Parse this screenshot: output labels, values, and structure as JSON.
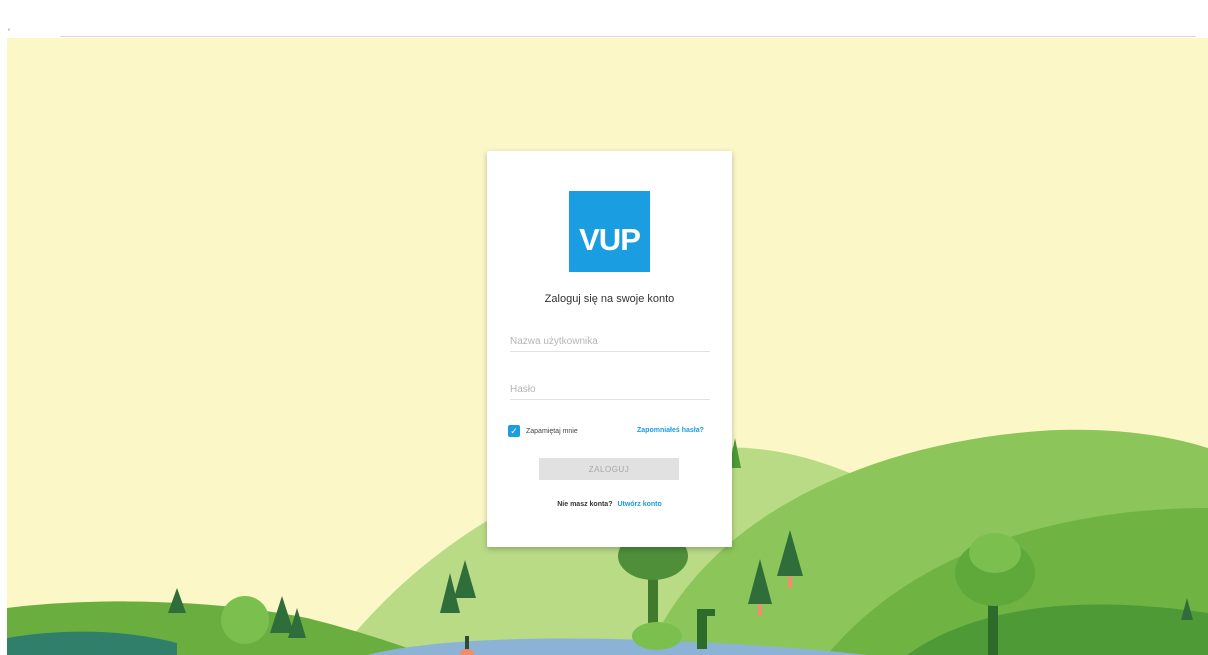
{
  "colors": {
    "background": "#fbf7c7",
    "accent": "#1a9de1",
    "hill_dark": "#5fa83a",
    "hill_light": "#b5d97f",
    "water": "#8cb3d6"
  },
  "logo": {
    "text": "VUP"
  },
  "login": {
    "title": "Zaloguj się na swoje konto",
    "username_placeholder": "Nazwa użytkownika",
    "username_value": "",
    "password_placeholder": "Hasło",
    "password_value": "",
    "remember_label": "Zapamiętaj mnie",
    "remember_checked": true,
    "forgot_link": "Zapomniałeś hasła?",
    "login_button": "ZALOGUJ",
    "no_account_text": "Nie masz konta?",
    "create_account_link": "Utwórz konto"
  },
  "icons": {
    "checkbox": "check-icon"
  }
}
